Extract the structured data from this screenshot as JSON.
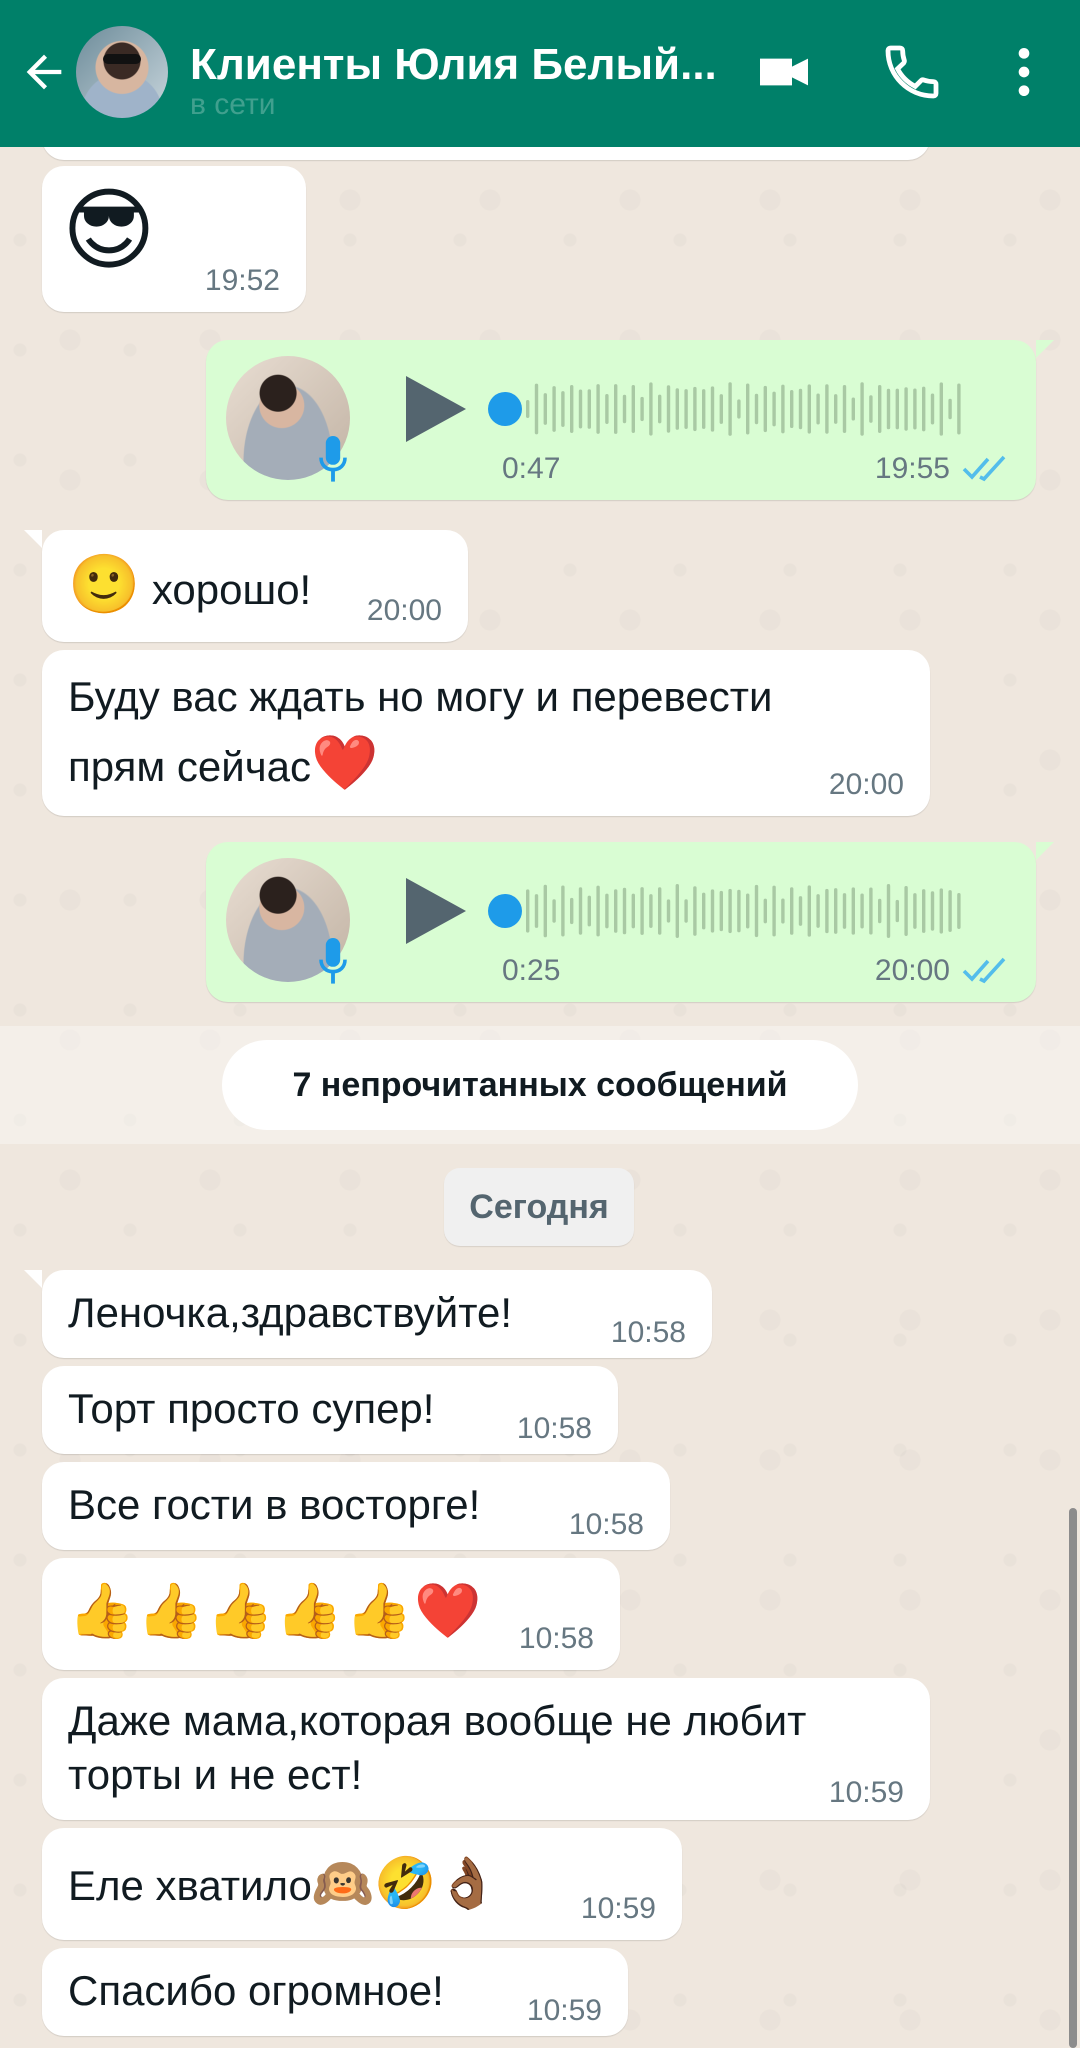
{
  "header": {
    "title": "Клиенты Юлия Белый...",
    "status": "в сети",
    "bg_color": "#008069"
  },
  "messages": [
    {
      "emoji": "😎",
      "time": "19:52"
    },
    {
      "voice_duration": "0:47",
      "time": "19:55"
    },
    {
      "text": "хорошо!",
      "emoji": "🙂",
      "time": "20:00"
    },
    {
      "line1": "Буду вас ждать но могу и перевести",
      "line2": "прям сейчас",
      "emoji": "❤️",
      "time": "20:00"
    },
    {
      "voice_duration": "0:25",
      "time": "20:00"
    },
    {
      "text": "Леночка,здравствуйте!",
      "time": "10:58"
    },
    {
      "text": "Торт просто супер!",
      "time": "10:58"
    },
    {
      "text": "Все гости в восторге!",
      "time": "10:58"
    },
    {
      "emoji": "👍👍👍👍👍❤️",
      "time": "10:58"
    },
    {
      "line1": "Даже мама,которая вообще не любит",
      "line2": "торты и не ест!",
      "time": "10:59"
    },
    {
      "text": "Еле хватило",
      "emoji": "🙉🤣👌🏾",
      "time": "10:59"
    },
    {
      "text": "Спасибо огромное!",
      "time": "10:59"
    }
  ],
  "unread_banner": "7 непрочитанных сообщений",
  "date_chip": "Сегодня",
  "icons": [
    "back-arrow-icon",
    "video-call-icon",
    "phone-icon",
    "more-vert-icon",
    "play-icon",
    "mic-icon",
    "double-check-icon"
  ],
  "colors": {
    "outgoing": "#d9fdd3",
    "incoming": "#ffffff",
    "read_ticks": "#53bdeb",
    "voice_dot": "#1e9be9"
  }
}
